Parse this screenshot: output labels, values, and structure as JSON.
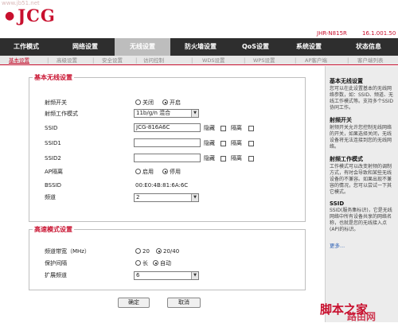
{
  "watermark_top": "www.jb51.net",
  "brand": {
    "logo": "JCG",
    "model": "JHR-N815R",
    "version": "16.1.001.50"
  },
  "nav": [
    "工作模式",
    "网络设置",
    "无线设置",
    "防火墙设置",
    "QoS设置",
    "系统设置",
    "状态信息"
  ],
  "subnav": [
    "基本设置",
    "高级设置",
    "安全设置",
    "访问控制",
    "WDS设置",
    "WPS设置",
    "AP客户端",
    "客户端列表"
  ],
  "basic": {
    "legend": "基本无线设置",
    "radio_switch": {
      "label": "射频开关",
      "off": "关闭",
      "on": "开启"
    },
    "mode": {
      "label": "射频工作模式",
      "value": "11b/g/n 混合"
    },
    "ssid": {
      "label": "SSID",
      "value": "JCG-816A6C"
    },
    "ssid1": {
      "label": "SSID1",
      "value": ""
    },
    "ssid2": {
      "label": "SSID2",
      "value": ""
    },
    "hide": "隐藏",
    "isolate": "隔离",
    "ap_isolation": {
      "label": "AP隔离",
      "on": "启用",
      "off": "停用"
    },
    "bssid": {
      "label": "BSSID",
      "value": "00:E0:4B:81:6A:6C"
    },
    "channel": {
      "label": "频道",
      "value": "2"
    }
  },
  "advanced": {
    "legend": "高速模式设置",
    "bandwidth": {
      "label": "频道带宽（MHz）",
      "opt1": "20",
      "opt2": "20/40"
    },
    "guard": {
      "label": "保护间隔",
      "opt1": "长",
      "opt2": "自动"
    },
    "ext_channel": {
      "label": "扩展频道",
      "value": "6"
    }
  },
  "buttons": {
    "ok": "确定",
    "cancel": "取消"
  },
  "help": [
    {
      "title": "基本无线设置",
      "text": "您可以在此设置基本的无线网络参数，如：SSID、频道、无线工作模式等。支持多个SSID协同工作。"
    },
    {
      "title": "射频开关",
      "text": "射频开关允许您控制无线网络的开关，如果选择关闭，无线设备将无法连接到您的无线网络。"
    },
    {
      "title": "射频工作模式",
      "text": "工作模式可以改变射频的调制方式，有时会导致和某些无线设备的不兼容。如果出现不兼容的情况，您可以尝试一下其它模式。"
    },
    {
      "title": "SSID",
      "text": "SSID(服务集标识)，它是无线网络中所有设备共享的网络名称，也就是您的无线接入点(AP)的标识。"
    }
  ],
  "help_more": "更多...",
  "watermark_bottom": {
    "line1": "脚本之家",
    "line2": "路由网"
  },
  "colors": {
    "accent": "#c8102e",
    "nav_bg": "#2e2e2e",
    "nav_active": "#bdbdbd"
  }
}
